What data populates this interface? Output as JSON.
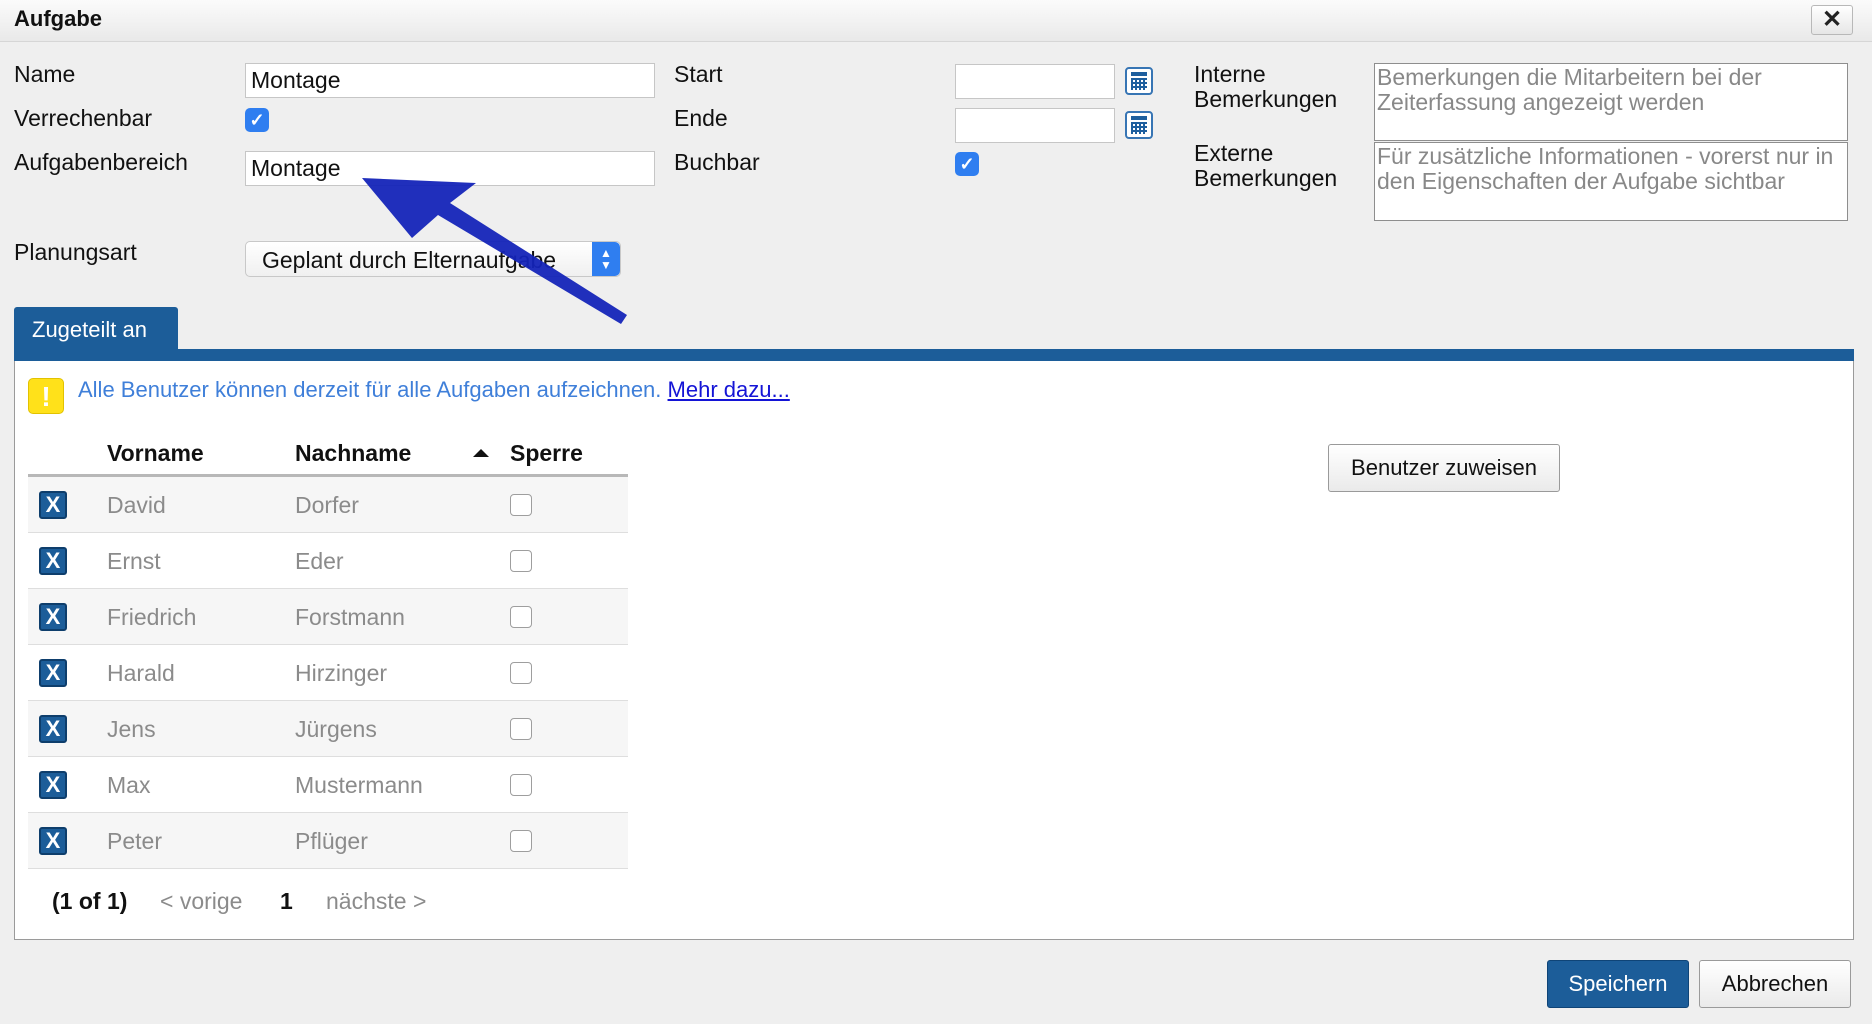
{
  "dialog": {
    "title": "Aufgabe",
    "close_label": "✕"
  },
  "form": {
    "name_label": "Name",
    "name_value": "Montage",
    "verrechenbar_label": "Verrechenbar",
    "verrechenbar_checked": true,
    "aufgabenbereich_label": "Aufgabenbereich",
    "aufgabenbereich_value": "Montage",
    "start_label": "Start",
    "start_value": "",
    "ende_label": "Ende",
    "ende_value": "",
    "buchbar_label": "Buchbar",
    "buchbar_checked": true,
    "interne_label_1": "Interne",
    "interne_label_2": "Bemerkungen",
    "interne_placeholder": "Bemerkungen die Mitarbeitern bei der Zeiterfassung angezeigt werden",
    "externe_label_1": "Externe",
    "externe_label_2": "Bemerkungen",
    "externe_placeholder": "Für zusätzliche Informationen - vorerst nur in den Eigenschaften der Aufgabe sichtbar",
    "planungsart_label": "Planungsart",
    "planungsart_value": "Geplant durch Elternaufgabe"
  },
  "tabs": {
    "active": "Zugeteilt an"
  },
  "info": {
    "icon": "warning-icon",
    "icon_glyph": "!",
    "message": "Alle Benutzer können derzeit für alle Aufgaben aufzeichnen.",
    "link": "Mehr dazu..."
  },
  "table": {
    "columns": {
      "vorname": "Vorname",
      "nachname": "Nachname",
      "sperre": "Sperre"
    },
    "sort": "Nachname ascending",
    "remove_glyph": "X",
    "rows": [
      {
        "vorname": "David",
        "nachname": "Dorfer",
        "sperre": false
      },
      {
        "vorname": "Ernst",
        "nachname": "Eder",
        "sperre": false
      },
      {
        "vorname": "Friedrich",
        "nachname": "Forstmann",
        "sperre": false
      },
      {
        "vorname": "Harald",
        "nachname": "Hirzinger",
        "sperre": false
      },
      {
        "vorname": "Jens",
        "nachname": "Jürgens",
        "sperre": false
      },
      {
        "vorname": "Max",
        "nachname": "Mustermann",
        "sperre": false
      },
      {
        "vorname": "Peter",
        "nachname": "Pflüger",
        "sperre": false
      }
    ]
  },
  "pager": {
    "summary": "(1 of 1)",
    "prev": "< vorige",
    "page": "1",
    "next": "nächste >"
  },
  "buttons": {
    "assign": "Benutzer zuweisen",
    "save": "Speichern",
    "cancel": "Abbrechen"
  },
  "colors": {
    "accent": "#1c5d99",
    "checkbox": "#2f7ef0",
    "info_text": "#3f7fd9",
    "annotation_arrow": "#1424b8"
  }
}
